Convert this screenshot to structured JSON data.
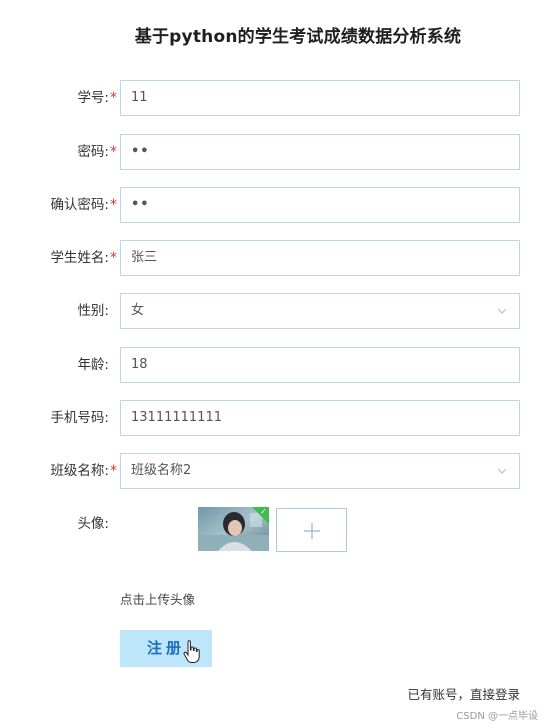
{
  "title": "基于python的学生考试成绩数据分析系统",
  "form": {
    "student_id": {
      "label": "学号:",
      "required": "*",
      "value": "11"
    },
    "password": {
      "label": "密码:",
      "required": "*",
      "value": "••"
    },
    "confirm_password": {
      "label": "确认密码:",
      "required": "*",
      "value": "••"
    },
    "student_name": {
      "label": "学生姓名:",
      "required": "*",
      "value": "张三"
    },
    "gender": {
      "label": "性别:",
      "value": "女"
    },
    "age": {
      "label": "年龄:",
      "value": "18"
    },
    "phone": {
      "label": "手机号码:",
      "value": "13111111111"
    },
    "class_name": {
      "label": "班级名称:",
      "required": "*",
      "value": "班级名称2"
    },
    "avatar": {
      "label": "头像:",
      "hint": "点击上传头像"
    }
  },
  "register_button": "注册",
  "login_link": "已有账号，直接登录",
  "watermark": "CSDN @一点毕设",
  "colors": {
    "accent": "#1b6ec2",
    "button_bg": "#bde6fb",
    "field_border": "#b9d5e8",
    "required": "#e0322e",
    "upload_success": "#3fbd4c"
  },
  "icons": {
    "select_arrow": "chevron-down-icon",
    "upload": "plus-icon",
    "uploaded": "check-icon",
    "cursor": "hand-pointer-icon"
  }
}
